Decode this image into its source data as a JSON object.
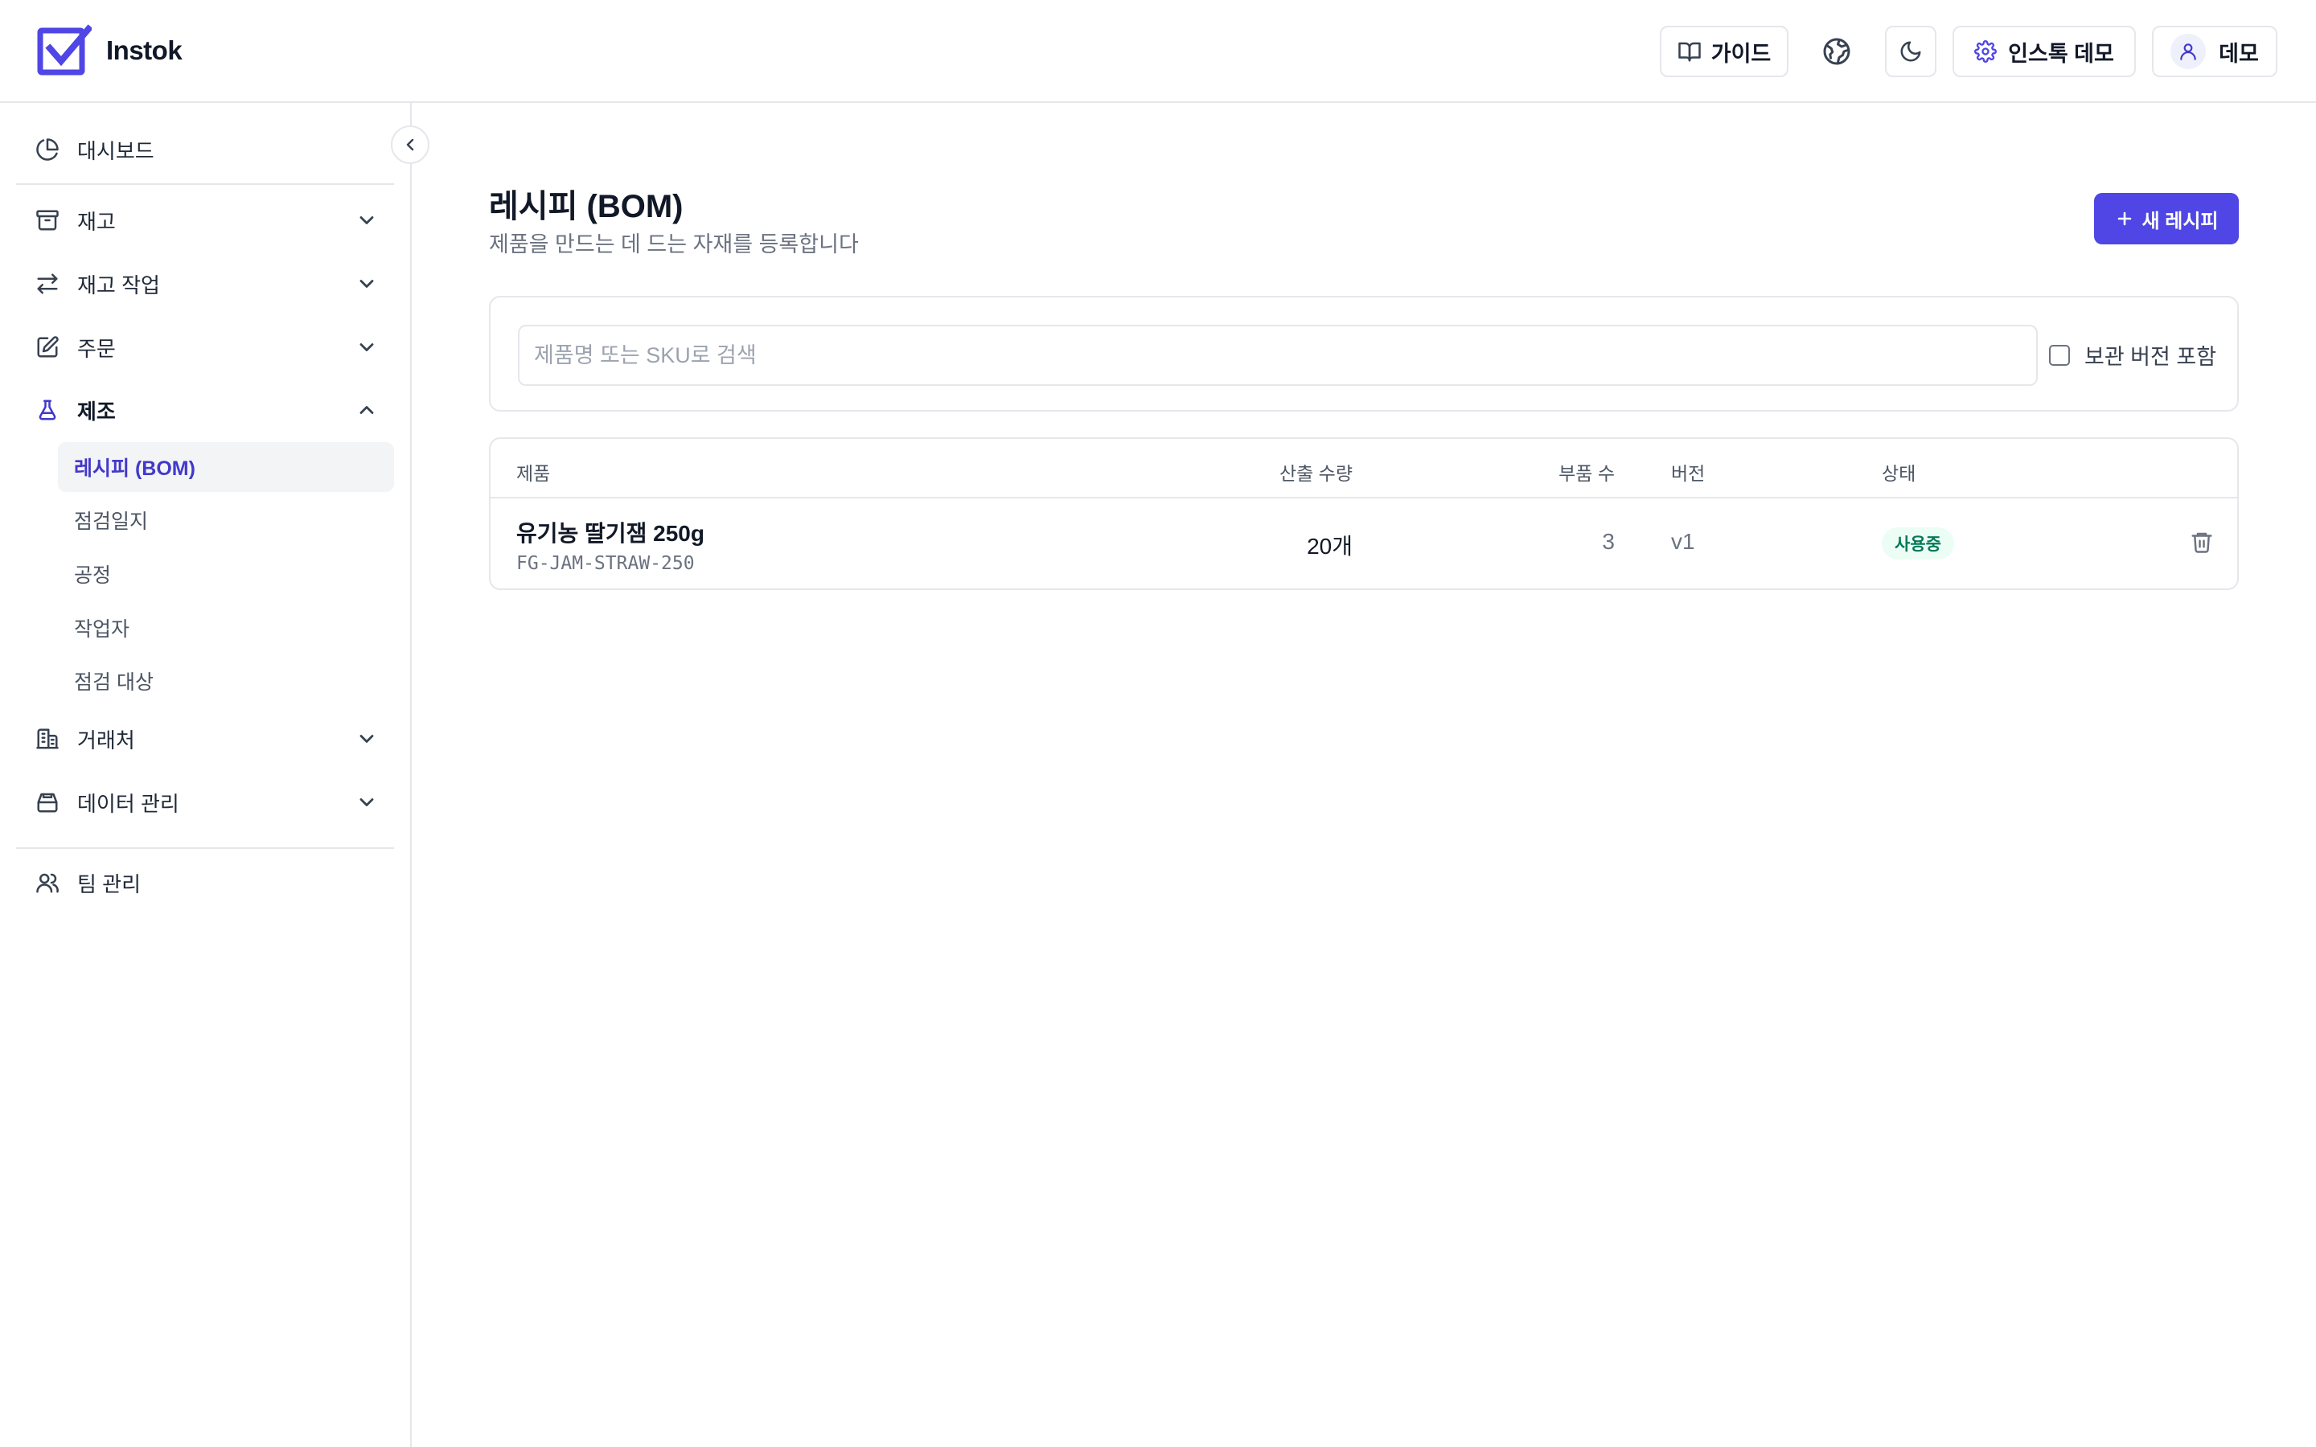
{
  "app": {
    "name": "Instok"
  },
  "header": {
    "guide_label": "가이드",
    "workspace_label": "인스톡 데모",
    "user_label": "데모",
    "icons": [
      "book-icon",
      "globe-icon",
      "moon-icon",
      "gear-icon",
      "user-icon"
    ]
  },
  "sidebar": {
    "dashboard": "대시보드",
    "inventory": "재고",
    "inventory_ops": "재고 작업",
    "orders": "주문",
    "manufacturing": "제조",
    "manufacturing_sub": {
      "recipe": "레시피 (BOM)",
      "inspection_log": "점검일지",
      "process": "공정",
      "worker": "작업자",
      "inspection_target": "점검 대상"
    },
    "partners": "거래처",
    "data_mgmt": "데이터 관리",
    "team": "팀 관리"
  },
  "main": {
    "title": "레시피 (BOM)",
    "subtitle": "제품을 만드는 데 드는 자재를 등록합니다",
    "new_button": "새 레시피",
    "search_placeholder": "제품명 또는 SKU로 검색",
    "search_value": "",
    "include_archived_label": "보관 버전 포함",
    "include_archived_checked": false
  },
  "table": {
    "columns": {
      "product": "제품",
      "yield": "산출 수량",
      "parts": "부품 수",
      "version": "버전",
      "status": "상태"
    },
    "rows": [
      {
        "product_name": "유기농 딸기잼 250g",
        "sku": "FG-JAM-STRAW-250",
        "yield": "20개",
        "parts": "3",
        "version": "v1",
        "status": "사용중"
      }
    ]
  },
  "colors": {
    "accent": "#4f46e5",
    "active_nav_text": "#4338ca",
    "status_bg": "#ecfdf5",
    "status_text": "#047857"
  }
}
